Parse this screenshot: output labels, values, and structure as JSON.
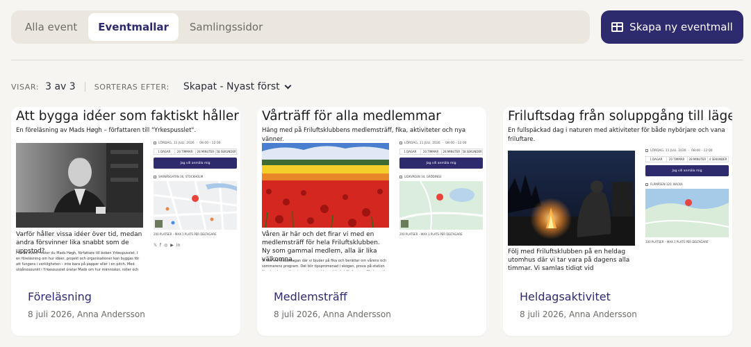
{
  "tabs": [
    {
      "label": "Alla event",
      "active": false
    },
    {
      "label": "Eventmallar",
      "active": true
    },
    {
      "label": "Samlingssidor",
      "active": false
    }
  ],
  "create_button": {
    "label": "Skapa ny eventmall",
    "icon": "layout-icon"
  },
  "meta": {
    "showing_label": "VISAR:",
    "showing_value": "3 av 3",
    "sort_label": "SORTERAS EFTER:",
    "sort_value": "Skapat - Nyast först"
  },
  "colors": {
    "brand": "#2e2a6e",
    "background": "#f6f5f1",
    "tabbar": "#ebe7df"
  },
  "cards": [
    {
      "type": "Föreläsning",
      "meta": "8 juli 2026, Anna Andersson",
      "preview": {
        "title": "Att bygga idéer som faktiskt håller",
        "subtitle": "En föreläsning av Mads Høgh – författaren till \"Yrkespusslet\".",
        "description": "Varför håller vissa idéer över tid, medan andra försvinner lika snabbt som de uppstod?",
        "body": "I detta event möter du Mads Høgh, författare till boken Yrkespusslet. I en föreläsning om hur idéer, projekt och organisationer kan byggas för att fungera i verkligheten – inte bara på papper eller i en pitch. Med utgångspunkt i Yrkespusslet pratar Mads om hur människor, roller och",
        "date": "LÖRDAG, 11 JULI, 2026",
        "time": "08:00 - 12:00",
        "countdown": [
          "1 DAGAR",
          "20 TIMMAR",
          "28 MINUTER",
          "58 SEKUNDER"
        ],
        "cta": "Jag vill anmäla mig",
        "address": "SARNÅSGATAN 36, STOCKHOLM",
        "spots": "200 PLATSER – MAX 1 PLATS PER DELTAGARE",
        "image": "portrait"
      }
    },
    {
      "type": "Medlemsträff",
      "meta": "8 juli 2026, Anna Andersson",
      "preview": {
        "title": "Vårträff för alla medlemmar",
        "subtitle": "Häng med på Friluftsklubbens medlemsträff, fika, aktiviteter och nya vänner.",
        "description": "Våren är här och det firar vi med en medlemsträff för hela Friluftsklubben. Ny som gammal medlem, alla är lika välkomna.",
        "body": "Vi ses vid klubbstugan där vi bjuder på fika och berättar om vårens och sommarens program. Det blir tipspromenad i skogen, prova på-station för utomhusmatlagning och en enklare aktivitet för barnen. Med en ett bra det bli",
        "date": "LÖRDAG, 11 JULI, 2026",
        "time": "08:00 - 12:00",
        "countdown": [
          "1 DAGAR",
          "20 TIMMAR",
          "28 MINUTER",
          "58 SEKUNDER"
        ],
        "cta": "Jag vill anmäla mig",
        "address": "LIDKVÄGEN 34, GRÖDINGE",
        "spots": "200 PLATSER – MAX 1 PLATS PER DELTAGARE",
        "image": "tulips"
      }
    },
    {
      "type": "Heldagsaktivitet",
      "meta": "8 juli 2026, Anna Andersson",
      "preview": {
        "title": "Friluftsdag från soluppgång till lägereld",
        "subtitle": "En fullspäckad dag i naturen med aktiviteter för både nybörjare och vana friluftare.",
        "description": "Följ med Friluftsklubben på en heldag utomhus där vi tar vara på dagens alla timmar. Vi samlas tidigt vid Skogsbrynets",
        "body": "",
        "date": "LÖRDAG, 11 JULI, 2026",
        "time": "08:00 - 12:00",
        "countdown": [
          "1 DAGAR",
          "20 TIMMAR",
          "28 MINUTER",
          "4 SEKUNDER"
        ],
        "cta": "Jag vill anmäla mig",
        "address": "FLÄMÅSEN 120, NACKA",
        "spots": "100 PLATSER – MAX 1 PLATS PER DELTAGARE",
        "image": "campfire"
      }
    }
  ]
}
